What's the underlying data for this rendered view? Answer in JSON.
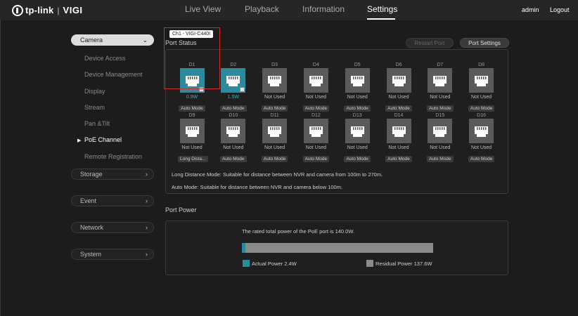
{
  "brand": {
    "name": "tp-link",
    "separator": "|",
    "product": "VIGI"
  },
  "nav": {
    "tabs": [
      {
        "label": "Live View"
      },
      {
        "label": "Playback"
      },
      {
        "label": "Information"
      },
      {
        "label": "Settings"
      }
    ],
    "active": "Settings",
    "user": "admin",
    "logout": "Logout"
  },
  "sidebar": {
    "camera": "Camera",
    "camera_items": [
      "Device Access",
      "Device Management",
      "Display",
      "Stream",
      "Pan &Tilt",
      "PoE Channel",
      "Remote Registration"
    ],
    "active_item": "PoE Channel",
    "storage": "Storage",
    "event": "Event",
    "network": "Network",
    "system": "System"
  },
  "port_status": {
    "title": "Port Status",
    "restart_btn": "Restart Port",
    "settings_btn": "Port Settings",
    "tooltip": "Ch1 - VIGI-C440I",
    "ports": [
      {
        "id": "D1",
        "status": "0.9W",
        "mode": "Auto Mode",
        "active": true
      },
      {
        "id": "D2",
        "status": "1.5W",
        "mode": "Auto Mode",
        "active": true
      },
      {
        "id": "D3",
        "status": "Not Used",
        "mode": "Auto Mode",
        "active": false
      },
      {
        "id": "D4",
        "status": "Not Used",
        "mode": "Auto Mode",
        "active": false
      },
      {
        "id": "D5",
        "status": "Not Used",
        "mode": "Auto Mode",
        "active": false
      },
      {
        "id": "D6",
        "status": "Not Used",
        "mode": "Auto Mode",
        "active": false
      },
      {
        "id": "D7",
        "status": "Not Used",
        "mode": "Auto Mode",
        "active": false
      },
      {
        "id": "D8",
        "status": "Not Used",
        "mode": "Auto Mode",
        "active": false
      },
      {
        "id": "D9",
        "status": "Not Used",
        "mode": "Long Dista...",
        "active": false
      },
      {
        "id": "D10",
        "status": "Not Used",
        "mode": "Auto Mode",
        "active": false
      },
      {
        "id": "D11",
        "status": "Not Used",
        "mode": "Auto Mode",
        "active": false
      },
      {
        "id": "D12",
        "status": "Not Used",
        "mode": "Auto Mode",
        "active": false
      },
      {
        "id": "D13",
        "status": "Not Used",
        "mode": "Auto Mode",
        "active": false
      },
      {
        "id": "D14",
        "status": "Not Used",
        "mode": "Auto Mode",
        "active": false
      },
      {
        "id": "D15",
        "status": "Not Used",
        "mode": "Auto Mode",
        "active": false
      },
      {
        "id": "D16",
        "status": "Not Used",
        "mode": "Auto Mode",
        "active": false
      }
    ],
    "note_long": "Long Distance Mode: Suitable for distance between NVR and camera from 100m to 270m.",
    "note_auto": "Auto Mode: Suitable for distance between NVR and camera below 100m."
  },
  "port_power": {
    "title": "Port Power",
    "rated_text": "The rated total power of the PoE port is 140.0W.",
    "actual_label": "Actual Power 2.4W",
    "residual_label": "Residual Power 137.6W",
    "actual_fraction": 0.017,
    "colors": {
      "actual": "#2a8a9e",
      "residual": "#8a8a8a"
    }
  }
}
